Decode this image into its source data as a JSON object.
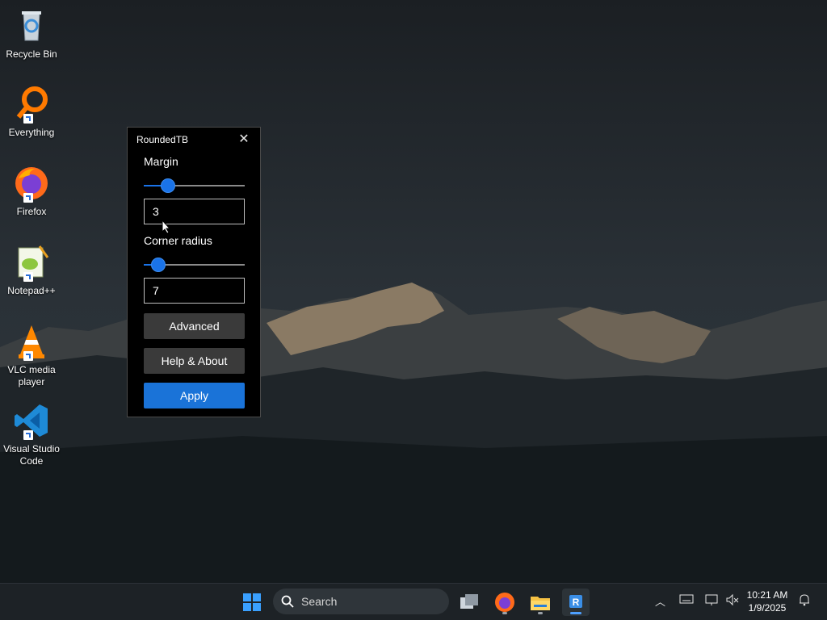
{
  "desktop": {
    "icons": [
      {
        "label": "Recycle Bin",
        "icon": "recycle-bin-icon"
      },
      {
        "label": "Everything",
        "icon": "everything-search-icon"
      },
      {
        "label": "Firefox",
        "icon": "firefox-icon"
      },
      {
        "label": "Notepad++",
        "icon": "notepad-plus-plus-icon"
      },
      {
        "label": "VLC media player",
        "icon": "vlc-icon"
      },
      {
        "label": "Visual Studio Code",
        "icon": "vscode-icon"
      }
    ]
  },
  "window": {
    "title": "RoundedTB",
    "close_icon": "close-icon",
    "margin_label": "Margin",
    "margin_slider_fraction": 0.2,
    "margin_value": "3",
    "corner_label": "Corner radius",
    "corner_slider_fraction": 0.08,
    "corner_value": "7",
    "advanced_label": "Advanced",
    "help_label": "Help & About",
    "apply_label": "Apply"
  },
  "taskbar": {
    "search_placeholder": "Search",
    "apps": [
      "start-icon",
      "task-view-icon",
      "firefox-icon",
      "file-explorer-icon",
      "roundedtb-icon"
    ],
    "tray_icons": [
      "chevron-up-icon",
      "keyboard-icon",
      "network-icon",
      "volume-muted-icon",
      "notification-bell-icon"
    ],
    "time": "10:21 AM",
    "date": "1/9/2025"
  },
  "colors": {
    "accent": "#1a73d8",
    "window_bg": "#000000",
    "taskbar_bg": "#1d2226"
  }
}
